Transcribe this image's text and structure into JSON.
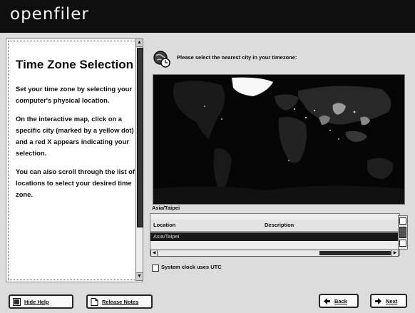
{
  "header": {
    "logo": "openfiler"
  },
  "help": {
    "title": "Time Zone Selection",
    "paragraphs": [
      "Set your time zone by selecting your computer's physical location.",
      "On the interactive map, click on a specific city (marked by a yellow dot) and a red X appears indicating your selection.",
      "You can also scroll through the list of locations to select your desired time zone."
    ]
  },
  "timezone": {
    "prompt": "Please select the nearest city in your timezone:",
    "selected_city": "Asia/Taipei",
    "table": {
      "columns": [
        "Location",
        "Description"
      ],
      "selected_row": "Asia/Taipei"
    },
    "utc_label": "System clock uses UTC",
    "utc_checked": false
  },
  "buttons": {
    "hide_help": "Hide Help",
    "release_notes": "Release Notes",
    "back": "Back",
    "next": "Next"
  },
  "icons": {
    "globe": "globe-clock-icon",
    "hide_help": "help-icon",
    "release_notes": "document-icon",
    "back": "back-arrow-icon",
    "next": "next-arrow-icon"
  }
}
